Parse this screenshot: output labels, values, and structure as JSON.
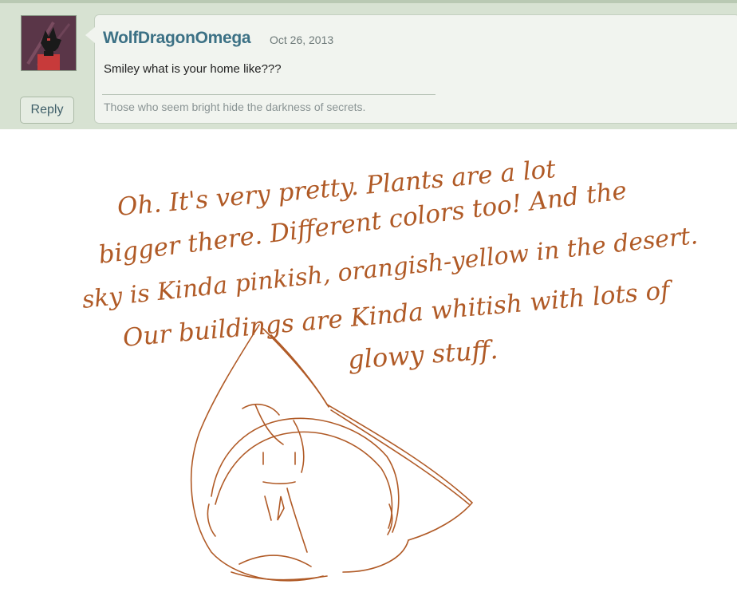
{
  "post": {
    "username": "WolfDragonOmega",
    "date": "Oct 26, 2013",
    "message": "Smiley what is your home like???",
    "signature": "Those who seem bright hide the darkness of secrets.",
    "reply_label": "Reply"
  },
  "drawing": {
    "lines": [
      "Oh. It's very pretty. Plants are a lot",
      "bigger there.  Different colors too! And the",
      "sky is Kinda pinkish, orangish-yellow in the desert.",
      "Our buildings are Kinda whitish with lots of",
      "glowy stuff."
    ],
    "ink_color": "#b05a26"
  },
  "colors": {
    "header_bg": "#d7e2d2",
    "username": "#3c7185",
    "card_bg": "#f1f4ef"
  },
  "icons": [
    "avatar-image"
  ]
}
